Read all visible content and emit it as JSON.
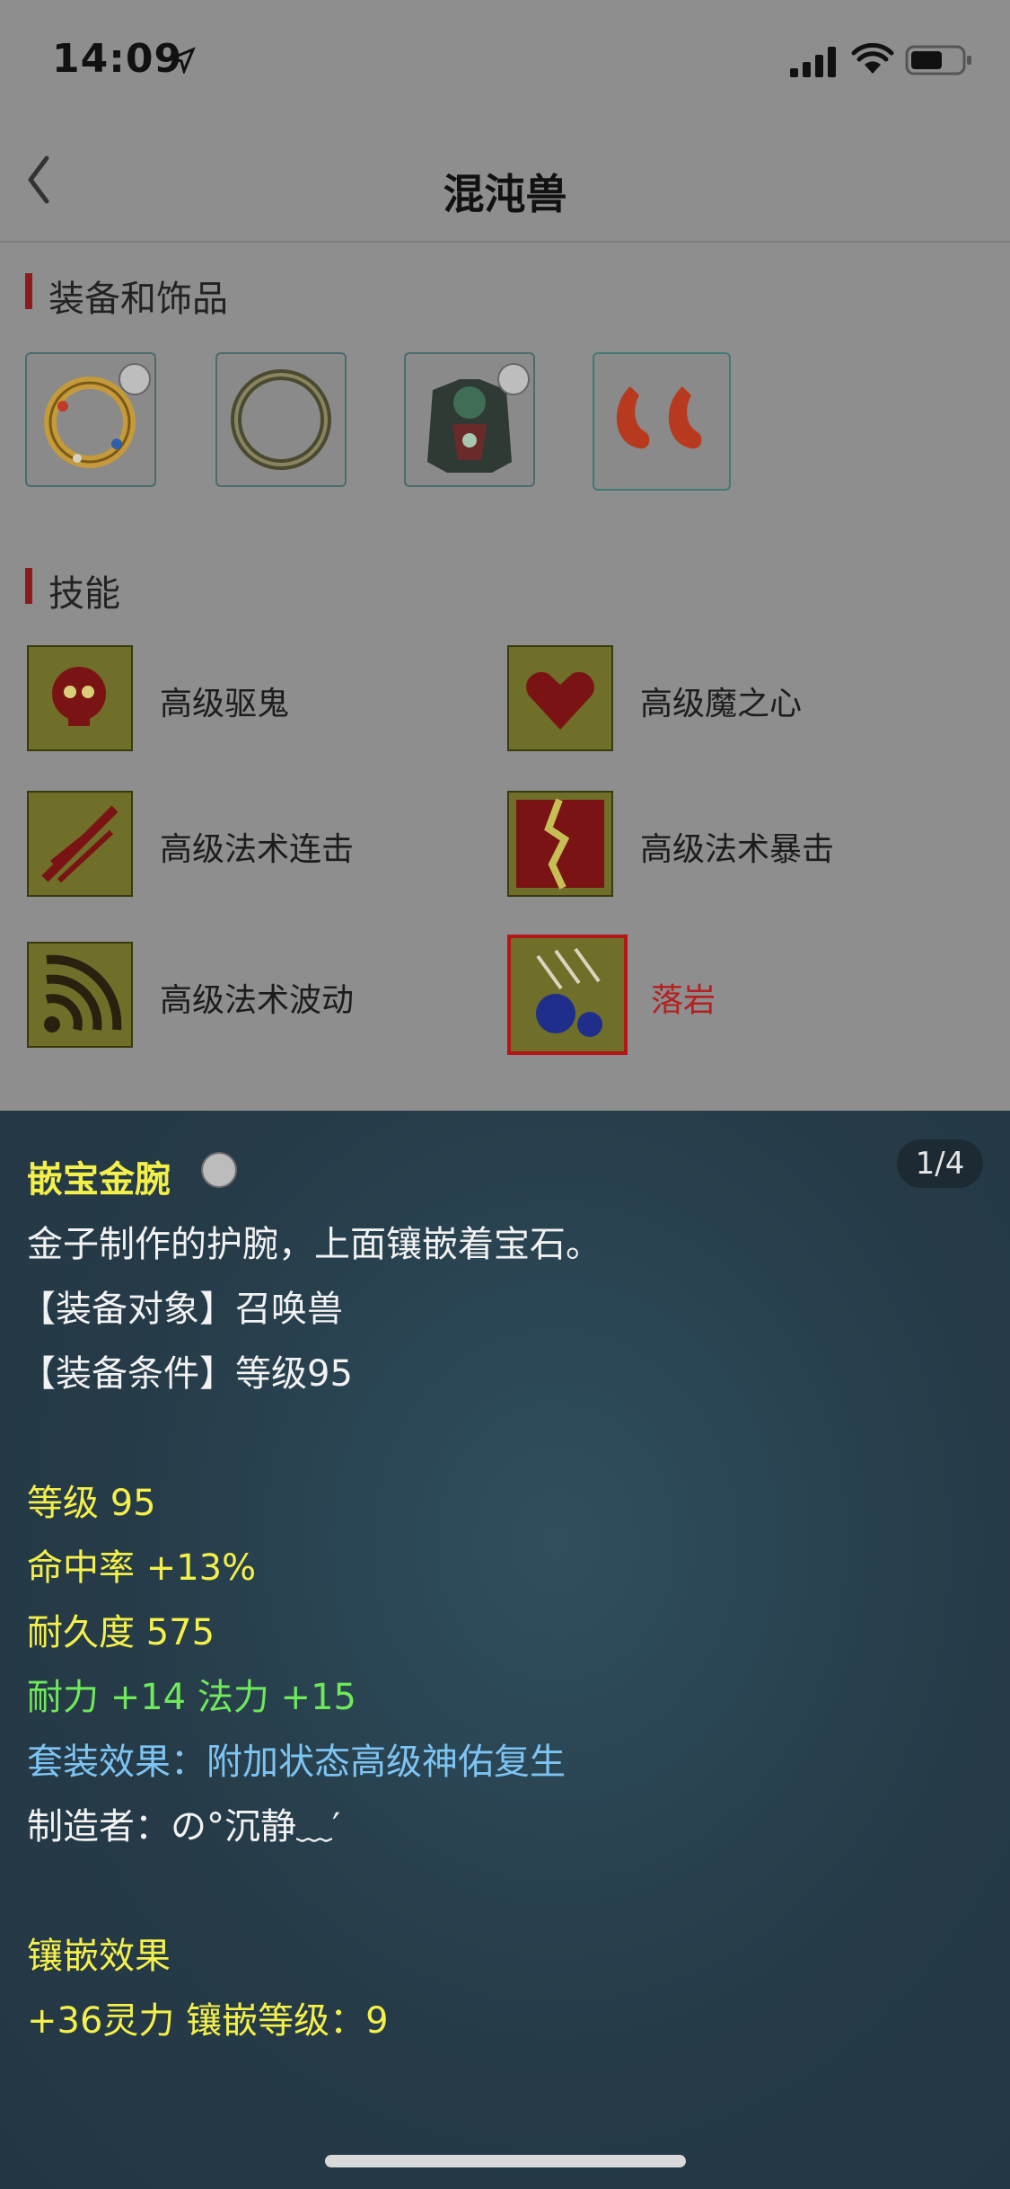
{
  "status_bar": {
    "time": "14:09"
  },
  "nav": {
    "title": "混沌兽"
  },
  "sections": {
    "equipment": "装备和饰品",
    "skills": "技能"
  },
  "skills": [
    {
      "name": "高级驱鬼"
    },
    {
      "name": "高级魔之心"
    },
    {
      "name": "高级法术连击"
    },
    {
      "name": "高级法术暴击"
    },
    {
      "name": "高级法术波动"
    },
    {
      "name": "落岩",
      "highlight_color": "#b52020"
    }
  ],
  "detail": {
    "pager": "1/4",
    "item_name": "嵌宝金腕",
    "description": "金子制作的护腕，上面镶嵌着宝石。",
    "target": "【装备对象】召唤兽",
    "requirement": "【装备条件】等级95",
    "stats": {
      "level": "等级 95",
      "hit_rate": "命中率 +13%",
      "durability": "耐久度 575",
      "bonus": "耐力 +14 法力 +15",
      "set_effect": "套装效果：附加状态高级神佑复生",
      "maker": "制造者：の°沉静﹏′"
    },
    "inlay_title": "镶嵌效果",
    "inlay_value": "+36灵力 镶嵌等级：9"
  },
  "colors": {
    "accent_bar": "#8c1c1c",
    "gold_text": "#f4f04a",
    "green_text": "#6fe85a",
    "blue_text": "#7ec4f2"
  },
  "icons": [
    "location-arrow-icon",
    "signal-icon",
    "wifi-icon",
    "battery-icon",
    "back-chevron-icon",
    "lock-icon"
  ]
}
